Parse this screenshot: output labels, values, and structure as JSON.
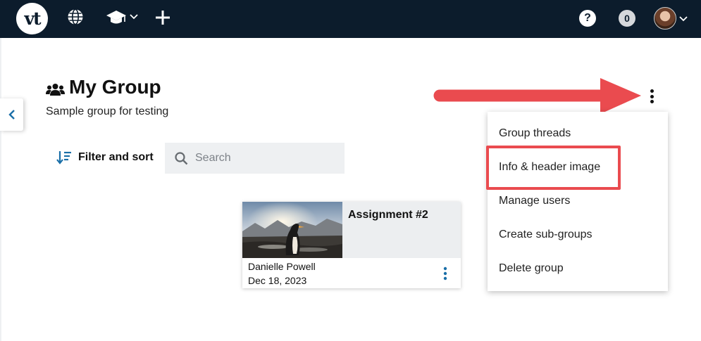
{
  "nav": {
    "logo_text": "vt",
    "icons": [
      "globe-icon",
      "graduation-cap-icon",
      "plus-icon"
    ],
    "help_label": "?",
    "notification_count": "0"
  },
  "header": {
    "title": "My Group",
    "subtitle": "Sample group for testing"
  },
  "toolbar": {
    "filter_label": "Filter and sort",
    "search_placeholder": "Search"
  },
  "card": {
    "title": "Assignment #2",
    "author": "Danielle Powell",
    "date": "Dec 18, 2023"
  },
  "menu": {
    "items": [
      "Group threads",
      "Info & header image",
      "Manage users",
      "Create sub-groups",
      "Delete group"
    ],
    "highlighted_index": 1
  },
  "colors": {
    "nav_bg": "#0c1c2c",
    "accent_blue": "#1a6fa8",
    "annotation_red": "#ea4b4f"
  }
}
